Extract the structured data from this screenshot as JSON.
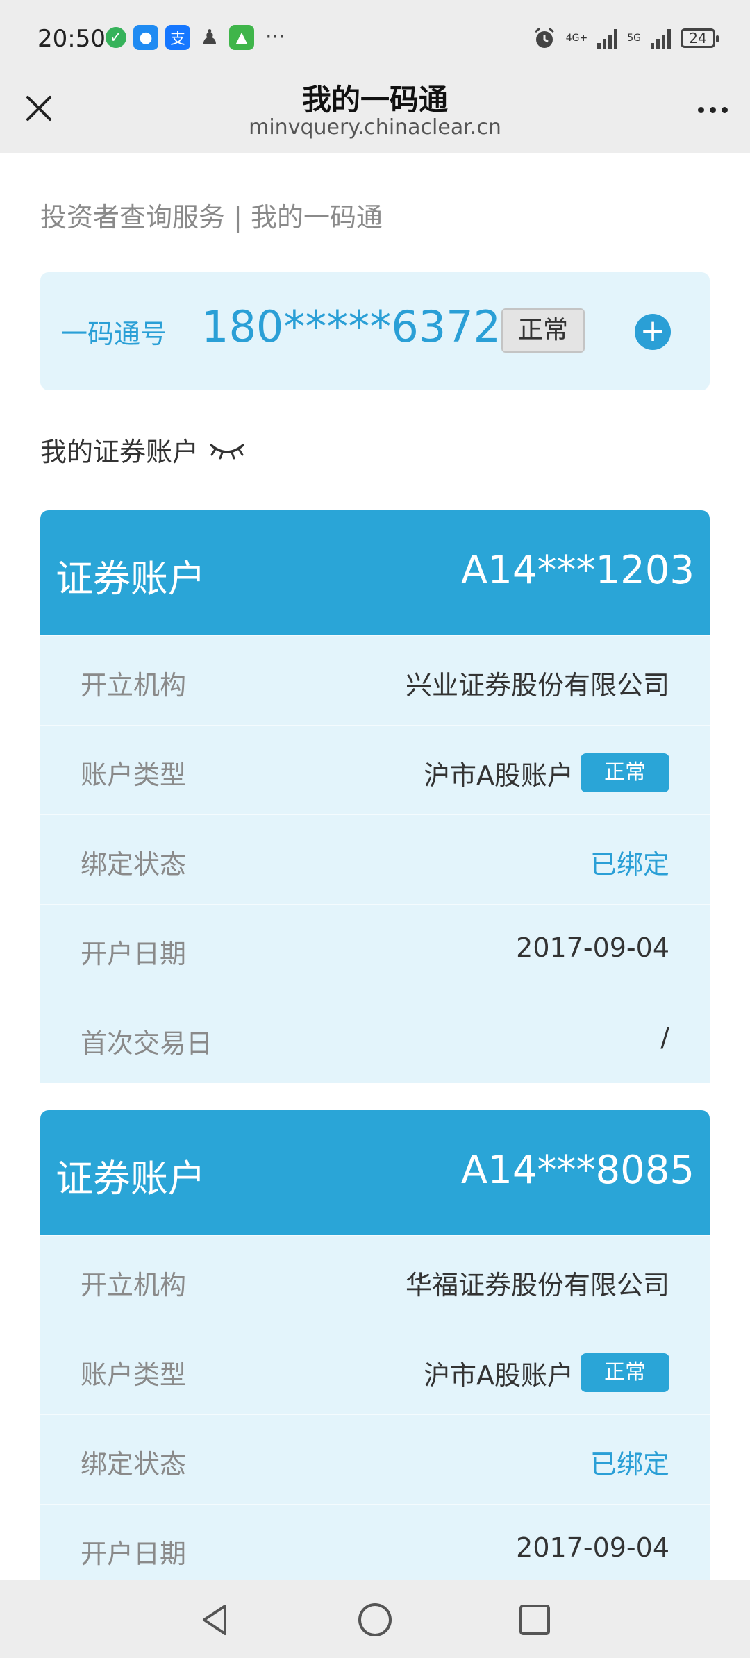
{
  "status_bar": {
    "time": "20:50",
    "notification_icons": [
      "shield-check-icon",
      "chat-app-icon",
      "alipay-icon",
      "qq-icon",
      "game-app-icon"
    ],
    "more": "···",
    "network1": "4G+",
    "network2": "5G",
    "battery": "24"
  },
  "titlebar": {
    "title": "我的一码通",
    "url": "minvquery.chinaclear.cn"
  },
  "breadcrumb": "投资者查询服务 | 我的一码通",
  "id_card": {
    "label": "一码通号",
    "number": "180*****6372",
    "status": "正常",
    "add_icon": "plus-circle-icon"
  },
  "section_title": "我的证券账户",
  "accounts": [
    {
      "header_label": "证券账户",
      "account_no": "A14***1203",
      "rows": {
        "institution_key": "开立机构",
        "institution_val": "兴业证券股份有限公司",
        "type_key": "账户类型",
        "type_val": "沪市A股账户",
        "type_badge": "正常",
        "bind_key": "绑定状态",
        "bind_val": "已绑定",
        "open_key": "开户日期",
        "open_val": "2017-09-04",
        "first_trade_key": "首次交易日",
        "first_trade_val": "/"
      }
    },
    {
      "header_label": "证券账户",
      "account_no": "A14***8085",
      "rows": {
        "institution_key": "开立机构",
        "institution_val": "华福证券股份有限公司",
        "type_key": "账户类型",
        "type_val": "沪市A股账户",
        "type_badge": "正常",
        "bind_key": "绑定状态",
        "bind_val": "已绑定",
        "open_key": "开户日期",
        "open_val": "2017-09-04"
      }
    }
  ],
  "colors": {
    "accent": "#2aa5d7",
    "card_bg": "#e3f4fb",
    "bar_bg": "#ededed"
  }
}
